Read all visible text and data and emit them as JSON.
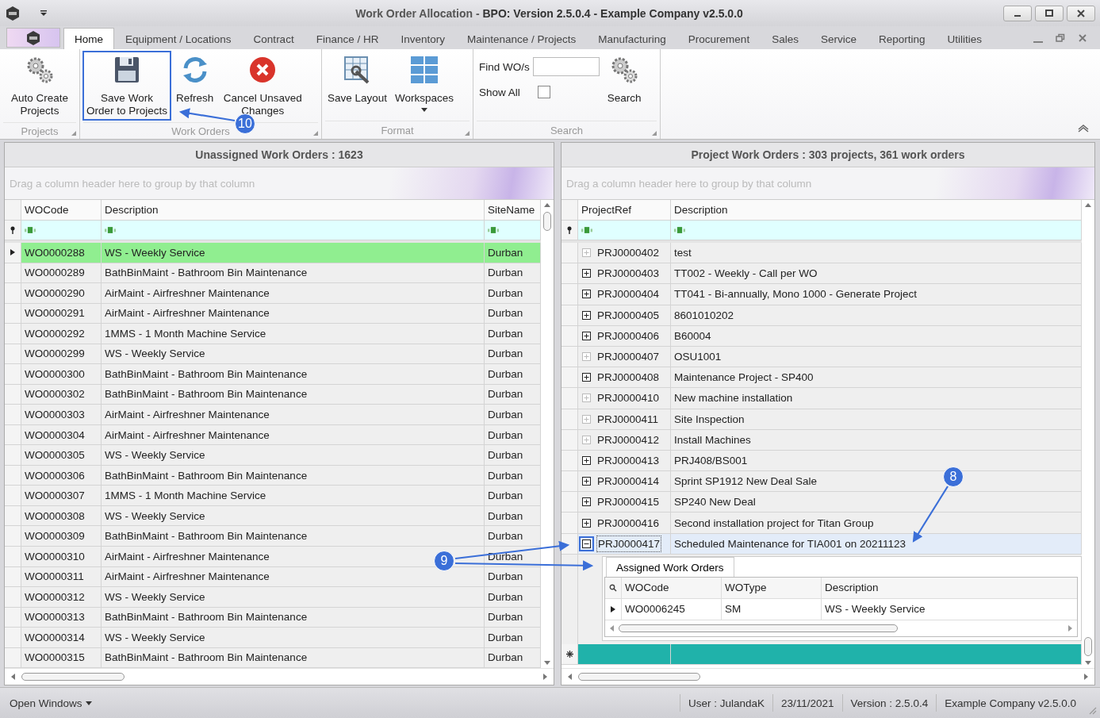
{
  "window": {
    "title": "Work Order Allocation - **BPO: Version 2.5.0.4 - Example Company v2.5.0.0**"
  },
  "ribbon_tabs": [
    {
      "label": "Home",
      "selected": true
    },
    {
      "label": "Equipment / Locations",
      "selected": false
    },
    {
      "label": "Contract",
      "selected": false
    },
    {
      "label": "Finance / HR",
      "selected": false
    },
    {
      "label": "Inventory",
      "selected": false
    },
    {
      "label": "Maintenance / Projects",
      "selected": false
    },
    {
      "label": "Manufacturing",
      "selected": false
    },
    {
      "label": "Procurement",
      "selected": false
    },
    {
      "label": "Sales",
      "selected": false
    },
    {
      "label": "Service",
      "selected": false
    },
    {
      "label": "Reporting",
      "selected": false
    },
    {
      "label": "Utilities",
      "selected": false
    }
  ],
  "ribbon_groups": [
    {
      "label": "Projects",
      "items": [
        {
          "kind": "button",
          "label": "Auto Create Projects",
          "highlighted": false
        }
      ]
    },
    {
      "label": "Work Orders",
      "items": [
        {
          "kind": "button",
          "label": "Save Work Order to Projects",
          "highlighted": true
        },
        {
          "kind": "button",
          "label": "Refresh",
          "highlighted": false
        },
        {
          "kind": "button",
          "label": "Cancel Unsaved Changes",
          "highlighted": false
        }
      ]
    },
    {
      "label": "Format",
      "items": [
        {
          "kind": "button",
          "label": "Save Layout",
          "highlighted": false
        },
        {
          "kind": "dropdown",
          "label": "Workspaces",
          "highlighted": false
        }
      ]
    },
    {
      "label": "Search",
      "items": [
        {
          "kind": "field",
          "label": "Find WO/s"
        },
        {
          "kind": "checkbox",
          "label": "Show All",
          "checked": false
        },
        {
          "kind": "button",
          "label": "Search",
          "highlighted": false
        }
      ]
    }
  ],
  "left_panel": {
    "title": "Unassigned Work Orders : 1623",
    "group_hint": "Drag a column header here to group by that column",
    "columns": [
      "WOCode",
      "Description",
      "SiteName"
    ],
    "rows": [
      {
        "wo_code": "WO0000288",
        "description": "WS - Weekly Service",
        "site": "Durban",
        "selected": true
      },
      {
        "wo_code": "WO0000289",
        "description": "BathBinMaint - Bathroom Bin Maintenance",
        "site": "Durban",
        "selected": false
      },
      {
        "wo_code": "WO0000290",
        "description": "AirMaint - Airfreshner Maintenance",
        "site": "Durban",
        "selected": false
      },
      {
        "wo_code": "WO0000291",
        "description": "AirMaint - Airfreshner Maintenance",
        "site": "Durban",
        "selected": false
      },
      {
        "wo_code": "WO0000292",
        "description": "1MMS - 1 Month Machine Service",
        "site": "Durban",
        "selected": false
      },
      {
        "wo_code": "WO0000299",
        "description": "WS - Weekly Service",
        "site": "Durban",
        "selected": false
      },
      {
        "wo_code": "WO0000300",
        "description": "BathBinMaint - Bathroom Bin Maintenance",
        "site": "Durban",
        "selected": false
      },
      {
        "wo_code": "WO0000302",
        "description": "BathBinMaint - Bathroom Bin Maintenance",
        "site": "Durban",
        "selected": false
      },
      {
        "wo_code": "WO0000303",
        "description": "AirMaint - Airfreshner Maintenance",
        "site": "Durban",
        "selected": false
      },
      {
        "wo_code": "WO0000304",
        "description": "AirMaint - Airfreshner Maintenance",
        "site": "Durban",
        "selected": false
      },
      {
        "wo_code": "WO0000305",
        "description": "WS - Weekly Service",
        "site": "Durban",
        "selected": false
      },
      {
        "wo_code": "WO0000306",
        "description": "BathBinMaint - Bathroom Bin Maintenance",
        "site": "Durban",
        "selected": false
      },
      {
        "wo_code": "WO0000307",
        "description": "1MMS - 1 Month Machine Service",
        "site": "Durban",
        "selected": false
      },
      {
        "wo_code": "WO0000308",
        "description": "WS - Weekly Service",
        "site": "Durban",
        "selected": false
      },
      {
        "wo_code": "WO0000309",
        "description": "BathBinMaint - Bathroom Bin Maintenance",
        "site": "Durban",
        "selected": false
      },
      {
        "wo_code": "WO0000310",
        "description": "AirMaint - Airfreshner Maintenance",
        "site": "Durban",
        "selected": false
      },
      {
        "wo_code": "WO0000311",
        "description": "AirMaint - Airfreshner Maintenance",
        "site": "Durban",
        "selected": false
      },
      {
        "wo_code": "WO0000312",
        "description": "WS - Weekly Service",
        "site": "Durban",
        "selected": false
      },
      {
        "wo_code": "WO0000313",
        "description": "BathBinMaint - Bathroom Bin Maintenance",
        "site": "Durban",
        "selected": false
      },
      {
        "wo_code": "WO0000314",
        "description": "WS - Weekly Service",
        "site": "Durban",
        "selected": false
      },
      {
        "wo_code": "WO0000315",
        "description": "BathBinMaint - Bathroom Bin Maintenance",
        "site": "Durban",
        "selected": false
      }
    ]
  },
  "right_panel": {
    "title": "Project Work Orders : 303 projects, 361 work orders",
    "group_hint": "Drag a column header here to group by that column",
    "columns": [
      "ProjectRef",
      "Description"
    ],
    "rows": [
      {
        "project_ref": "PRJ0000402",
        "description": "test",
        "has_children": false,
        "expanded": false,
        "selected": false,
        "highlighted": false
      },
      {
        "project_ref": "PRJ0000403",
        "description": "TT002 - Weekly - Call per WO",
        "has_children": true,
        "expanded": false,
        "selected": false,
        "highlighted": false
      },
      {
        "project_ref": "PRJ0000404",
        "description": "TT041 - Bi-annually, Mono 1000 - Generate Project",
        "has_children": true,
        "expanded": false,
        "selected": false,
        "highlighted": false
      },
      {
        "project_ref": "PRJ0000405",
        "description": "8601010202",
        "has_children": true,
        "expanded": false,
        "selected": false,
        "highlighted": false
      },
      {
        "project_ref": "PRJ0000406",
        "description": "B60004",
        "has_children": true,
        "expanded": false,
        "selected": false,
        "highlighted": false
      },
      {
        "project_ref": "PRJ0000407",
        "description": "OSU1001",
        "has_children": false,
        "expanded": false,
        "selected": false,
        "highlighted": false
      },
      {
        "project_ref": "PRJ0000408",
        "description": "Maintenance Project - SP400",
        "has_children": true,
        "expanded": false,
        "selected": false,
        "highlighted": false
      },
      {
        "project_ref": "PRJ0000410",
        "description": "New machine installation",
        "has_children": false,
        "expanded": false,
        "selected": false,
        "highlighted": false
      },
      {
        "project_ref": "PRJ0000411",
        "description": "Site Inspection",
        "has_children": false,
        "expanded": false,
        "selected": false,
        "highlighted": false
      },
      {
        "project_ref": "PRJ0000412",
        "description": "Install Machines",
        "has_children": false,
        "expanded": false,
        "selected": false,
        "highlighted": false
      },
      {
        "project_ref": "PRJ0000413",
        "description": "PRJ408/BS001",
        "has_children": true,
        "expanded": false,
        "selected": false,
        "highlighted": false
      },
      {
        "project_ref": "PRJ0000414",
        "description": "Sprint SP1912 New Deal Sale",
        "has_children": true,
        "expanded": false,
        "selected": false,
        "highlighted": false
      },
      {
        "project_ref": "PRJ0000415",
        "description": "SP240 New Deal",
        "has_children": true,
        "expanded": false,
        "selected": false,
        "highlighted": false
      },
      {
        "project_ref": "PRJ0000416",
        "description": "Second installation project for Titan Group",
        "has_children": true,
        "expanded": false,
        "selected": false,
        "highlighted": false
      },
      {
        "project_ref": "PRJ0000417",
        "description": "Scheduled Maintenance for TIA001 on 20211123",
        "has_children": true,
        "expanded": true,
        "selected": true,
        "highlighted": true,
        "detail": {
          "tab": "Assigned Work Orders",
          "columns": [
            "WOCode",
            "WOType",
            "Description"
          ],
          "rows": [
            {
              "cells": [
                "WO0006245",
                "SM",
                "WS - Weekly Service"
              ]
            }
          ]
        }
      }
    ]
  },
  "status_bar": {
    "open_windows": "Open Windows",
    "items": [
      "User : JulandaK",
      "23/11/2021",
      "Version : 2.5.0.4",
      "Example Company v2.5.0.0"
    ]
  },
  "callouts": [
    {
      "label": "10"
    },
    {
      "label": "9"
    },
    {
      "label": "8"
    }
  ]
}
